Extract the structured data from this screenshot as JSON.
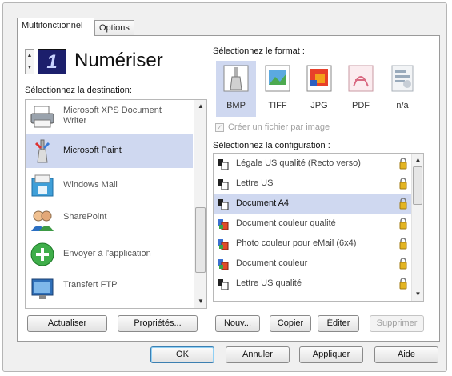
{
  "tabs": [
    {
      "label": "Multifonctionnel",
      "active": true
    },
    {
      "label": "Options",
      "active": false
    }
  ],
  "scanner": {
    "display_number": "1",
    "title": "Numériser",
    "lcd_color": "#1c1f6c"
  },
  "destination": {
    "label": "Sélectionnez la destination:",
    "items": [
      {
        "label": "Microsoft XPS Document Writer",
        "icon": "printer-icon",
        "selected": false
      },
      {
        "label": "Microsoft Paint",
        "icon": "paint-icon",
        "selected": true
      },
      {
        "label": "Windows Mail",
        "icon": "mail-icon",
        "selected": false
      },
      {
        "label": "SharePoint",
        "icon": "sharepoint-icon",
        "selected": false
      },
      {
        "label": "Envoyer à l'application",
        "icon": "send-app-icon",
        "selected": false
      },
      {
        "label": "Transfert FTP",
        "icon": "ftp-icon",
        "selected": false
      }
    ]
  },
  "format": {
    "label": "Sélectionnez le format :",
    "items": [
      {
        "label": "BMP",
        "icon": "bmp-icon",
        "selected": true
      },
      {
        "label": "TIFF",
        "icon": "tiff-icon",
        "selected": false
      },
      {
        "label": "JPG",
        "icon": "jpg-icon",
        "selected": false
      },
      {
        "label": "PDF",
        "icon": "pdf-icon",
        "selected": false
      },
      {
        "label": "n/a",
        "icon": "na-icon",
        "selected": false
      }
    ],
    "checkbox_label": "Créer un fichier par image",
    "checkbox_checked": true,
    "checkbox_enabled": false
  },
  "configuration": {
    "label": "Sélectionnez la configuration :",
    "items": [
      {
        "label": "Légale US qualité (Recto verso)",
        "icon": "bw-doc-icon",
        "selected": false
      },
      {
        "label": "Lettre US",
        "icon": "bw-doc-icon",
        "selected": false
      },
      {
        "label": "Document A4",
        "icon": "bw-doc-icon",
        "selected": true
      },
      {
        "label": "Document couleur qualité",
        "icon": "color-doc-icon",
        "selected": false
      },
      {
        "label": "Photo couleur pour eMail (6x4)",
        "icon": "color-doc-icon",
        "selected": false
      },
      {
        "label": "Document couleur",
        "icon": "color-doc-icon",
        "selected": false
      },
      {
        "label": "Lettre US qualité",
        "icon": "bw-doc-icon",
        "selected": false
      }
    ]
  },
  "buttons": {
    "refresh": "Actualiser",
    "properties": "Propriétés...",
    "new": "Nouv...",
    "copy": "Copier",
    "edit": "Éditer",
    "delete": "Supprimer",
    "ok": "OK",
    "cancel": "Annuler",
    "apply": "Appliquer",
    "help": "Aide"
  },
  "colors": {
    "selection": "#cfd8f0",
    "lock": "#e3b423"
  }
}
